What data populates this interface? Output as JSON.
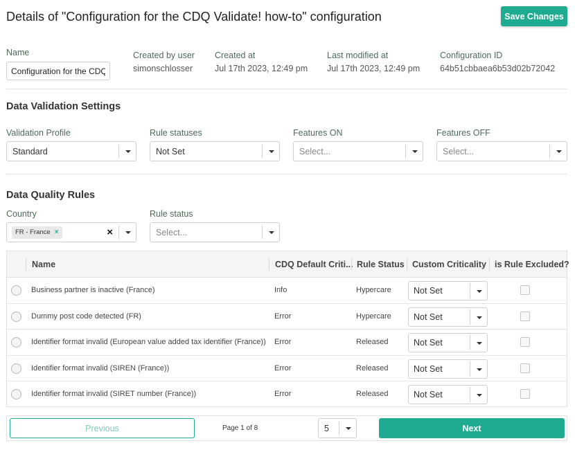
{
  "header": {
    "title": "Details of \"Configuration for the CDQ Validate! how-to\" configuration",
    "save_label": "Save Changes"
  },
  "meta": {
    "name_label": "Name",
    "name_value": "Configuration for the CDQ",
    "created_by_label": "Created by user",
    "created_by_value": "simonschlosser",
    "created_at_label": "Created at",
    "created_at_value": "Jul 17th 2023, 12:49 pm",
    "modified_label": "Last modified at",
    "modified_value": "Jul 17th 2023, 12:49 pm",
    "config_id_label": "Configuration ID",
    "config_id_value": "64b51cbbaea6b53d02b72042"
  },
  "validation": {
    "heading": "Data Validation Settings",
    "profile_label": "Validation Profile",
    "profile_value": "Standard",
    "rule_statuses_label": "Rule statuses",
    "rule_statuses_value": "Not Set",
    "features_on_label": "Features ON",
    "features_on_placeholder": "Select...",
    "features_off_label": "Features OFF",
    "features_off_placeholder": "Select..."
  },
  "rules": {
    "heading": "Data Quality Rules",
    "country_label": "Country",
    "country_chip": "FR - France",
    "chip_remove": "×",
    "clear": "×",
    "rule_status_label": "Rule status",
    "rule_status_placeholder": "Select..."
  },
  "table": {
    "headers": [
      "Name",
      "CDQ Default Criti...",
      "Rule Status",
      "Custom Criticality",
      "is Rule Excluded?"
    ],
    "rows": [
      {
        "name": "Business partner is inactive (France)",
        "criticality": "Info",
        "status": "Hypercare",
        "custom": "Not Set"
      },
      {
        "name": "Dummy post code detected (FR)",
        "criticality": "Error",
        "status": "Hypercare",
        "custom": "Not Set"
      },
      {
        "name": "Identifier format invalid (European value added tax identifier (France))",
        "criticality": "Error",
        "status": "Released",
        "custom": "Not Set"
      },
      {
        "name": "Identifier format invalid (SIREN (France))",
        "criticality": "Error",
        "status": "Released",
        "custom": "Not Set"
      },
      {
        "name": "Identifier format invalid (SIRET number (France))",
        "criticality": "Error",
        "status": "Released",
        "custom": "Not Set"
      }
    ]
  },
  "pagination": {
    "previous_label": "Previous",
    "page_info": "Page 1 of 8",
    "page_size": "5",
    "next_label": "Next"
  },
  "colors": {
    "accent": "#1fab8f",
    "label_green": "#4e6b57"
  },
  "icons": {
    "caret": "chevron-down-icon",
    "clear": "close-icon",
    "radio": "radio-icon",
    "checkbox": "checkbox-icon"
  }
}
